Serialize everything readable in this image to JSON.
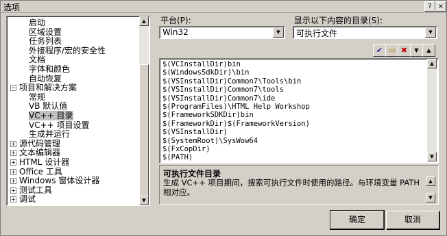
{
  "window": {
    "title": "选项"
  },
  "title_buttons": {
    "help": "?",
    "close": "×"
  },
  "tree": {
    "items": [
      {
        "label": "启动",
        "level": 2,
        "expander": ""
      },
      {
        "label": "区域设置",
        "level": 2,
        "expander": ""
      },
      {
        "label": "任务列表",
        "level": 2,
        "expander": ""
      },
      {
        "label": "外接程序/宏的安全性",
        "level": 2,
        "expander": ""
      },
      {
        "label": "文档",
        "level": 2,
        "expander": ""
      },
      {
        "label": "字体和颜色",
        "level": 2,
        "expander": ""
      },
      {
        "label": "自动恢复",
        "level": 2,
        "expander": ""
      },
      {
        "label": "项目和解决方案",
        "level": 1,
        "expander": "−"
      },
      {
        "label": "常规",
        "level": 2,
        "expander": ""
      },
      {
        "label": "VB 默认值",
        "level": 2,
        "expander": ""
      },
      {
        "label": "VC++ 目录",
        "level": 2,
        "expander": "",
        "selected": true
      },
      {
        "label": "VC++ 项目设置",
        "level": 2,
        "expander": ""
      },
      {
        "label": "生成并运行",
        "level": 2,
        "expander": ""
      },
      {
        "label": "源代码管理",
        "level": 1,
        "expander": "+"
      },
      {
        "label": "文本编辑器",
        "level": 1,
        "expander": "+"
      },
      {
        "label": "HTML 设计器",
        "level": 1,
        "expander": "+"
      },
      {
        "label": "Office 工具",
        "level": 1,
        "expander": "+"
      },
      {
        "label": "Windows 窗体设计器",
        "level": 1,
        "expander": "+"
      },
      {
        "label": "测试工具",
        "level": 1,
        "expander": "+"
      },
      {
        "label": "调试",
        "level": 1,
        "expander": "+"
      }
    ]
  },
  "platform": {
    "label": "平台(P):",
    "value": "Win32"
  },
  "directories": {
    "label": "显示以下内容的目录(S):",
    "value": "可执行文件"
  },
  "toolbar": {
    "check": "✔",
    "new_folder": "▭",
    "delete": "✖",
    "move_down": "▼",
    "move_up": "▲"
  },
  "paths": [
    "$(VCInstallDir)bin",
    "$(WindowsSdkDir)\\bin",
    "$(VSInstallDir)Common7\\Tools\\bin",
    "$(VSInstallDir)Common7\\tools",
    "$(VSInstallDir)Common7\\ide",
    "$(ProgramFiles)\\HTML Help Workshop",
    "$(FrameworkSDKDir)bin",
    "$(FrameworkDir)$(FrameworkVersion)",
    "$(VSInstallDir)",
    "$(SystemRoot)\\SysWow64",
    "$(FxCopDir)",
    "$(PATH)"
  ],
  "description": {
    "title": "可执行文件目录",
    "text": "生成 VC++ 项目期间，搜索可执行文件时使用的路径。与环境变量 PATH 相对应。"
  },
  "buttons": {
    "ok": "确定",
    "cancel": "取消"
  },
  "colors": {
    "dialog_bg": "#d4d0c8",
    "selected_bg": "#c0c0c0"
  }
}
